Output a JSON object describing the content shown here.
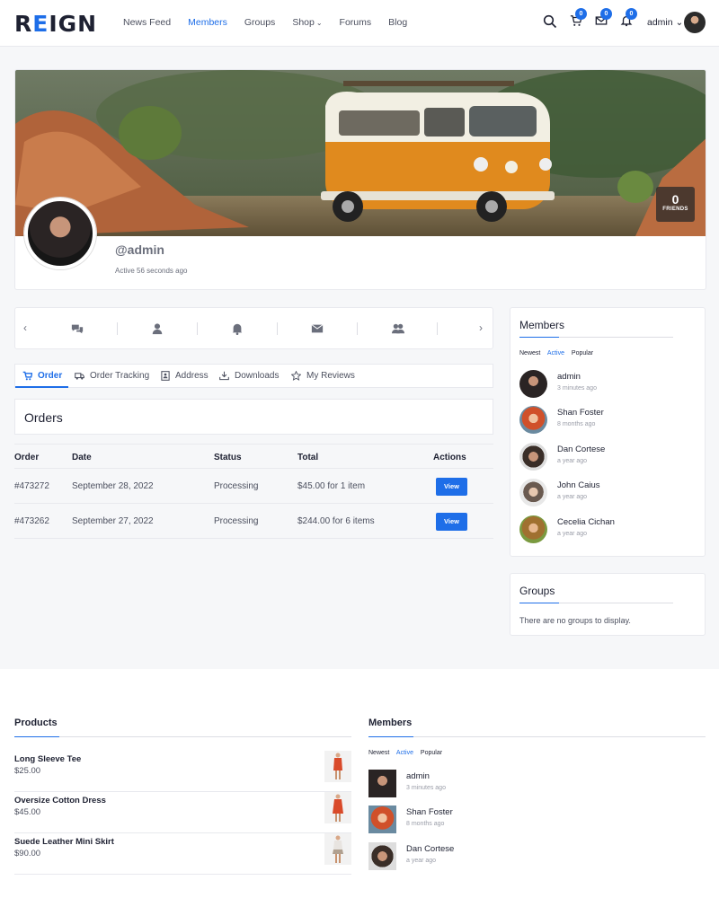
{
  "header": {
    "logo": "REIGN",
    "nav": [
      "News Feed",
      "Members",
      "Groups",
      "Shop",
      "Forums",
      "Blog"
    ],
    "active_nav": "Members",
    "cart_count": "0",
    "messages_count": "0",
    "notifications_count": "0",
    "user_label": "admin"
  },
  "profile": {
    "friends_count": "0",
    "friends_label": "FRIENDS",
    "username": "@admin",
    "active_text": "Active 56 seconds ago"
  },
  "woo_tabs": [
    "Order",
    "Order Tracking",
    "Address",
    "Downloads",
    "My Reviews"
  ],
  "orders": {
    "title": "Orders",
    "columns": [
      "Order",
      "Date",
      "Status",
      "Total",
      "Actions"
    ],
    "rows": [
      {
        "order": "#473272",
        "date": "September 28, 2022",
        "status": "Processing",
        "total": "$45.00 for 1 item",
        "action": "View"
      },
      {
        "order": "#473262",
        "date": "September 27, 2022",
        "status": "Processing",
        "total": "$244.00 for 6 items",
        "action": "View"
      }
    ]
  },
  "sidebar_members": {
    "title": "Members",
    "filters": [
      "Newest",
      "Active",
      "Popular"
    ],
    "active_filter": "Active",
    "members": [
      {
        "name": "admin",
        "time": "3 minutes ago"
      },
      {
        "name": "Shan Foster",
        "time": "8 months ago"
      },
      {
        "name": "Dan Cortese",
        "time": "a year ago"
      },
      {
        "name": "John Caius",
        "time": "a year ago"
      },
      {
        "name": "Cecelia Cichan",
        "time": "a year ago"
      }
    ]
  },
  "sidebar_groups": {
    "title": "Groups",
    "empty": "There are no groups to display."
  },
  "footer_products": {
    "title": "Products",
    "items": [
      {
        "name": "Long Sleeve Tee",
        "price": "$25.00"
      },
      {
        "name": "Oversize Cotton Dress",
        "price": "$45.00"
      },
      {
        "name": "Suede Leather Mini Skirt",
        "price": "$90.00"
      }
    ]
  },
  "footer_members": {
    "title": "Members",
    "filters": [
      "Newest",
      "Active",
      "Popular"
    ],
    "members": [
      {
        "name": "admin",
        "time": "3 minutes ago"
      },
      {
        "name": "Shan Foster",
        "time": "8 months ago"
      },
      {
        "name": "Dan Cortese",
        "time": "a year ago"
      }
    ]
  },
  "colors": {
    "accent": "#1e6ee8",
    "text": "#1e2132",
    "background": "#f6f7f9"
  }
}
